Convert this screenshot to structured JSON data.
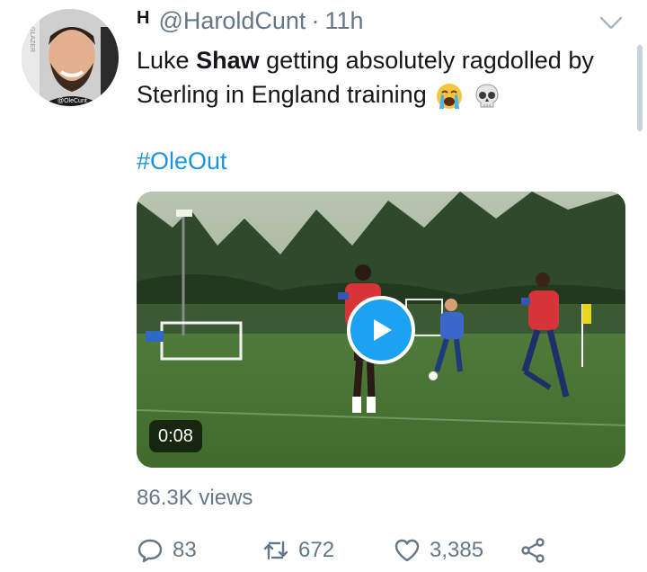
{
  "tweet": {
    "display_name": "H",
    "handle": "@HaroldCunt",
    "separator": "·",
    "time": "11h",
    "text_before": "Luke ",
    "text_bold": "Shaw",
    "text_after": " getting absolutely ragdolled by Sterling in England training",
    "emojis": [
      "crying-face-icon",
      "skull-icon"
    ],
    "hashtag": "#OleOut",
    "avatar_caption": "@OleCunt",
    "avatar_sign": "GLAZER"
  },
  "video": {
    "duration": "0:08"
  },
  "stats": {
    "views": "86.3K views"
  },
  "actions": {
    "reply_count": "83",
    "retweet_count": "672",
    "like_count": "3,385"
  },
  "colors": {
    "link": "#1b95e0",
    "muted": "#657786",
    "play": "#1da1f2"
  }
}
